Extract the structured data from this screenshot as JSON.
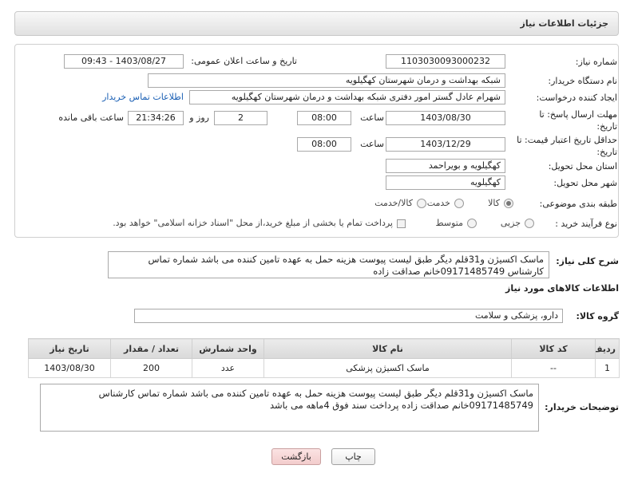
{
  "header": {
    "title": "جزئیات اطلاعات نیاز"
  },
  "need": {
    "number_label": "شماره نیاز:",
    "number": "1103030093000232",
    "announce_label": "تاریخ و ساعت اعلان عمومی:",
    "announce_value": "1403/08/27 - 09:43",
    "buyer_label": "نام دستگاه خریدار:",
    "buyer_value": "شبکه بهداشت و درمان شهرستان کهگیلویه",
    "creator_label": "ایجاد کننده درخواست:",
    "creator_value": "شهرام عادل گستر امور دفتری شبکه بهداشت و درمان شهرستان کهگیلویه",
    "contact_link": "اطلاعات تماس خریدار",
    "deadline_label": "مهلت ارسال پاسخ: تا\nتاریخ:",
    "deadline_date": "1403/08/30",
    "deadline_time_label": "ساعت",
    "deadline_time": "08:00",
    "days_remaining": "2",
    "days_label": "روز و",
    "time_remaining": "21:34:26",
    "time_remaining_label": "ساعت باقی مانده",
    "validity_label": "حداقل تاریخ اعتبار قیمت: تا\nتاریخ:",
    "validity_date": "1403/12/29",
    "validity_time_label": "ساعت",
    "validity_time": "08:00",
    "province_label": "استان محل تحویل:",
    "province_value": "کهگیلویه و بویراحمد",
    "city_label": "شهر محل تحویل:",
    "city_value": "کهگیلویه",
    "category_label": "طبقه بندی موضوعی:",
    "category_options": [
      {
        "label": "کالا",
        "selected": true
      },
      {
        "label": "خدمت",
        "selected": false
      },
      {
        "label": "کالا/خدمت",
        "selected": false
      }
    ],
    "process_label": "نوع فرآیند خرید :",
    "process_options": [
      {
        "label": "جزیی",
        "selected": false
      },
      {
        "label": "متوسط",
        "selected": false
      }
    ],
    "treasury_label": "پرداخت تمام یا بخشی از مبلغ خرید،از محل \"اسناد خزانه اسلامی\" خواهد بود.",
    "treasury_checked": false
  },
  "description": {
    "label": "شرح کلی نیاز:",
    "text": "ماسک اکسیژن و31قلم دیگر طبق لیست پیوست هزینه حمل به عهده تامین کننده می باشد شماره تماس کارشناس 09171485749خانم صداقت زاده"
  },
  "goods": {
    "heading": "اطلاعات کالاهای مورد نیاز",
    "group_label": "گروه کالا:",
    "group_value": "دارو، پزشکی و سلامت",
    "columns": [
      "ردیف",
      "کد کالا",
      "نام کالا",
      "واحد شمارش",
      "تعداد / مقدار",
      "تاریخ نیاز"
    ],
    "rows": [
      [
        "1",
        "--",
        "ماسک اکسیژن پزشکی",
        "عدد",
        "200",
        "1403/08/30"
      ]
    ]
  },
  "buyer_notes": {
    "label": "توضیحات خریدار:",
    "text": "ماسک اکسیژن و31قلم دیگر طبق لیست پیوست هزینه حمل به عهده تامین کننده می باشد شماره تماس کارشناس 09171485749خانم صداقت زاده پرداخت سند فوق 4ماهه می باشد"
  },
  "actions": {
    "print": "چاپ",
    "back": "بازگشت"
  }
}
